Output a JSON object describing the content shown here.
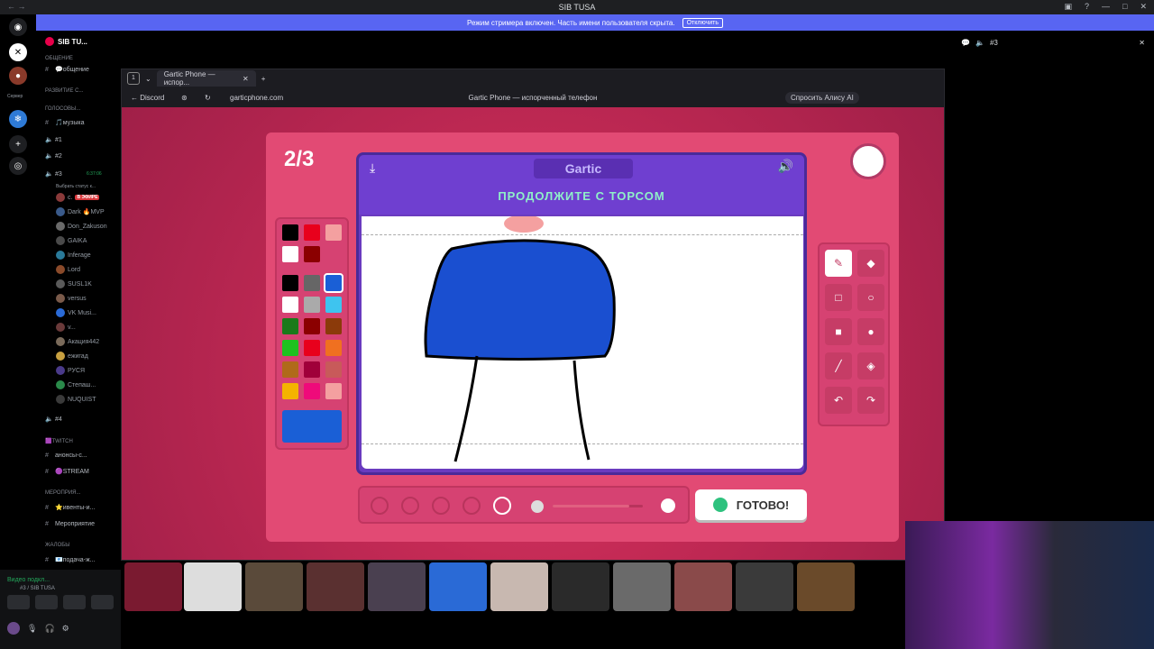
{
  "window": {
    "title": "SIB TUSA",
    "streamer_notice": "Режим стримера включен. Часть имени пользователя скрыта.",
    "streamer_button": "Отключить"
  },
  "rail": {
    "label": "Сервер"
  },
  "sidebar": {
    "server_name": "SIB TU...",
    "rows": [
      {
        "type": "cat",
        "label": "ОБЩЕНИЕ"
      },
      {
        "type": "text",
        "label": "💬общение"
      },
      {
        "type": "cat",
        "label": "РАЗВИТИЕ С..."
      },
      {
        "type": "cat",
        "label": "ГОЛОСОВЫ..."
      },
      {
        "type": "text",
        "label": "🎵музыка"
      },
      {
        "type": "voice",
        "label": "#1"
      },
      {
        "type": "voice",
        "label": "#2"
      },
      {
        "type": "voice",
        "label": "#3"
      },
      {
        "type": "status",
        "label": "Выбрать статус к..."
      },
      {
        "type": "user",
        "label": "с.",
        "badge": "В ЭФИРЕ"
      },
      {
        "type": "user",
        "label": "Dark 🔥MVP"
      },
      {
        "type": "user",
        "label": "Don_Zakuson"
      },
      {
        "type": "user",
        "label": "GAIKA"
      },
      {
        "type": "user",
        "label": "Inferage"
      },
      {
        "type": "user",
        "label": "Lord"
      },
      {
        "type": "user",
        "label": "SUSL1K"
      },
      {
        "type": "user",
        "label": "versus"
      },
      {
        "type": "user",
        "label": "VK Musi..."
      },
      {
        "type": "user",
        "label": "v..."
      },
      {
        "type": "user",
        "label": "Акация442"
      },
      {
        "type": "user",
        "label": "ежигад"
      },
      {
        "type": "user",
        "label": "РУСЯ"
      },
      {
        "type": "user",
        "label": "Степаш..."
      },
      {
        "type": "user",
        "label": "NUQUIST"
      },
      {
        "type": "voice",
        "label": "#4"
      },
      {
        "type": "cat",
        "label": "🟪TWITCH"
      },
      {
        "type": "text",
        "label": "анонсы-с..."
      },
      {
        "type": "text",
        "label": "🟣STREAM"
      },
      {
        "type": "cat",
        "label": "МЕРОПРИЯ..."
      },
      {
        "type": "text",
        "label": "⭐ивенты-и..."
      },
      {
        "type": "text",
        "label": "Мероприятие"
      },
      {
        "type": "cat",
        "label": "ЖАЛОБЫ"
      },
      {
        "type": "text",
        "label": "📧подача-ж..."
      }
    ],
    "timer": "6:37:06",
    "voice_status": "Видео подкл...",
    "voice_channel": "#3 / SIB TUSA"
  },
  "browser": {
    "tab_title": "Gartic Phone — испор...",
    "back_label": "Discord",
    "url": "garticphone.com",
    "page_title": "Gartic Phone — испорченный телефон",
    "alice_label": "Спросить Алису AI"
  },
  "game": {
    "round": "2/3",
    "logo": "Gartic",
    "prompt": "ПРОДОЛЖИТЕ С ТОРСОМ",
    "done_label": "ГОТОВО!",
    "palette": [
      "#000000",
      "#e8001c",
      "#f4a0a0",
      "#ffffff",
      "#8b0000",
      "#000000",
      "#666666",
      "#1a5fd6",
      "#ffffff",
      "#aaaaaa",
      "#3ec4ef",
      "#1a7a1a",
      "#8b0000",
      "#8b3a0a",
      "#1fc21f",
      "#e8001c",
      "#f07020",
      "#b06a1a",
      "#a0003a",
      "#c85a5a",
      "#f4b400",
      "#ef0a7a",
      "#f4a0a0"
    ],
    "selected_color": "#1a5fd6",
    "brush_size_level": 0.85
  },
  "right_panel": {
    "channel": "#3"
  }
}
